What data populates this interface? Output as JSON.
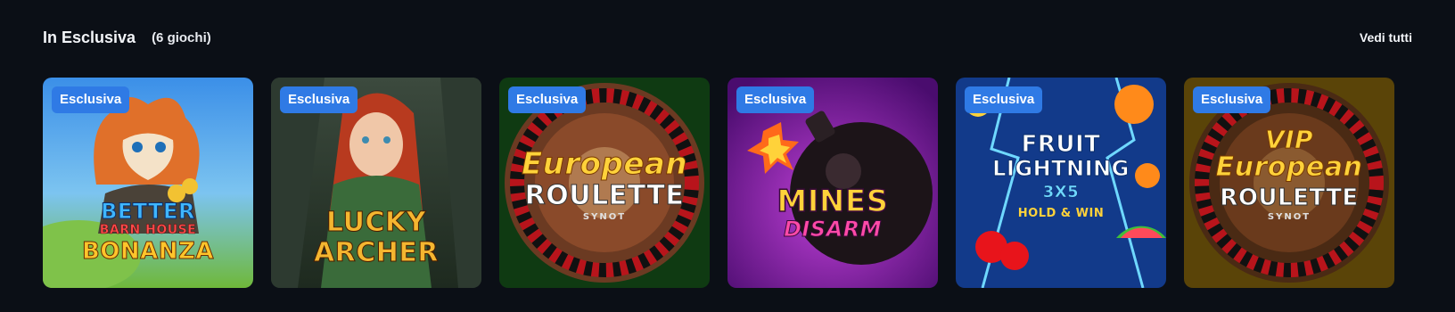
{
  "section": {
    "title": "In Esclusiva",
    "count": "(6 giochi)",
    "see_all": "Vedi tutti"
  },
  "games": [
    {
      "badge": "Esclusiva",
      "line1": "BETTER",
      "line2": "BARN HOUSE",
      "line3": "BONANZA"
    },
    {
      "badge": "Esclusiva",
      "line1": "LUCKY",
      "line2": "ARCHER"
    },
    {
      "badge": "Esclusiva",
      "line1": "European",
      "line2": "ROULETTE",
      "brand": "SYNOT"
    },
    {
      "badge": "Esclusiva",
      "line1": "MINES",
      "line2": "DISARM"
    },
    {
      "badge": "Esclusiva",
      "line1": "FRUIT",
      "line2": "LIGHTNING",
      "line3": "3X5",
      "line4": "HOLD & WIN"
    },
    {
      "badge": "Esclusiva",
      "line1": "VIP",
      "line2": "European",
      "line3": "ROULETTE",
      "brand": "SYNOT"
    }
  ],
  "colors": {
    "background": "#0b0f16",
    "badge": "#2f7ae5"
  }
}
